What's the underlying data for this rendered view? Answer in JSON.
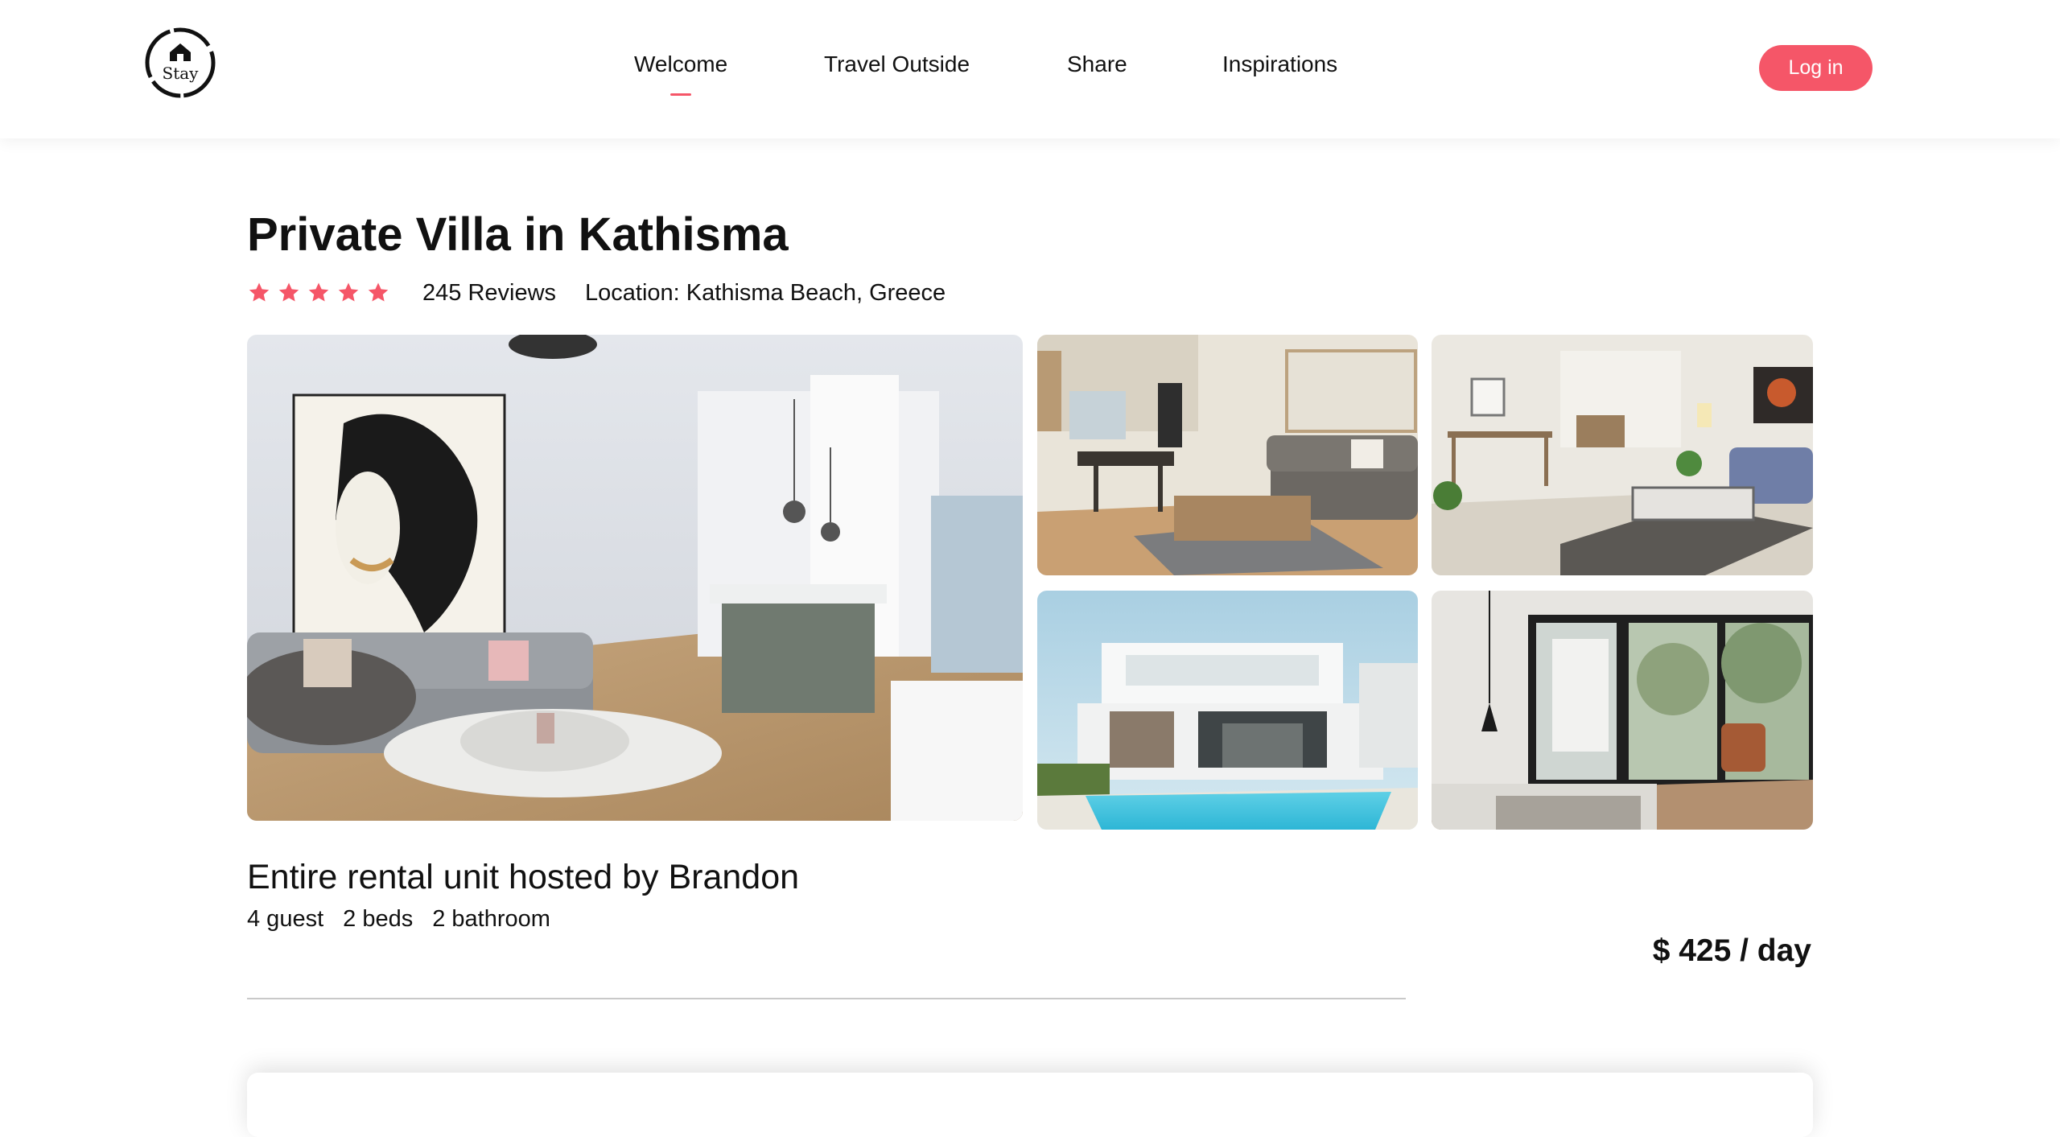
{
  "brand": {
    "logo_text": "Stay",
    "accent_color": "#f55668"
  },
  "nav": {
    "items": [
      {
        "label": "Welcome",
        "active": true
      },
      {
        "label": "Travel Outside",
        "active": false
      },
      {
        "label": "Share",
        "active": false
      },
      {
        "label": "Inspirations",
        "active": false
      }
    ],
    "login_label": "Log in"
  },
  "listing": {
    "title": "Private Villa in Kathisma",
    "rating": 5,
    "reviews": "245 Reviews",
    "location": "Location: Kathisma Beach, Greece",
    "host_line": "Entire rental unit hosted by Brandon",
    "specs": [
      "4 guest",
      "2 beds",
      "2 bathroom"
    ],
    "price": "$ 425 / day"
  },
  "gallery": [
    {
      "icon": "living-room-kitchen-photo"
    },
    {
      "icon": "living-room-dining-photo"
    },
    {
      "icon": "living-room-carpet-photo"
    },
    {
      "icon": "modern-villa-pool-photo"
    },
    {
      "icon": "bedroom-window-photo"
    }
  ]
}
